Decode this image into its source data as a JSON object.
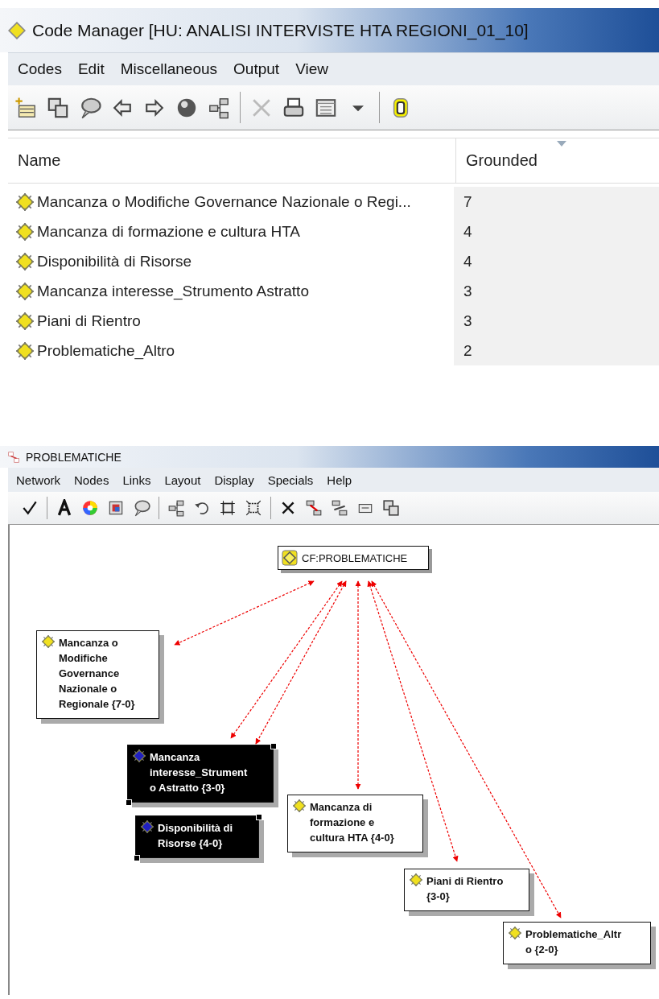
{
  "code_manager": {
    "title": "Code Manager [HU: ANALISI INTERVISTE HTA REGIONI_01_10]",
    "menu": [
      "Codes",
      "Edit",
      "Miscellaneous",
      "Output",
      "View"
    ],
    "columns": [
      "Name",
      "Grounded"
    ],
    "rows": [
      {
        "name": "Mancanza o Modifiche Governance Nazionale o Regi...",
        "grounded": "7"
      },
      {
        "name": "Mancanza di formazione e cultura HTA",
        "grounded": "4"
      },
      {
        "name": "Disponibilità di Risorse",
        "grounded": "4"
      },
      {
        "name": "Mancanza interesse_Strumento Astratto",
        "grounded": "3"
      },
      {
        "name": "Piani di Rientro",
        "grounded": "3"
      },
      {
        "name": "Problematiche_Altro",
        "grounded": "2"
      }
    ]
  },
  "network": {
    "title": "PROBLEMATICHE",
    "menu": [
      "Network",
      "Nodes",
      "Links",
      "Layout",
      "Display",
      "Specials",
      "Help"
    ],
    "nodes": [
      {
        "kind": "family",
        "lines": [
          "CF:PROBLEMATICHE"
        ],
        "selected": false
      },
      {
        "kind": "code",
        "lines": [
          "Mancanza o",
          "Modifiche",
          "Governance",
          "Nazionale o",
          "Regionale {7-0}"
        ],
        "selected": false
      },
      {
        "kind": "code",
        "lines": [
          "Mancanza",
          "interesse_Strument",
          "o Astratto {3-0}"
        ],
        "selected": true
      },
      {
        "kind": "code",
        "lines": [
          "Disponibilità di",
          "Risorse {4-0}"
        ],
        "selected": true
      },
      {
        "kind": "code",
        "lines": [
          "Mancanza di",
          "formazione e",
          "cultura HTA {4-0}"
        ],
        "selected": false
      },
      {
        "kind": "code",
        "lines": [
          "Piani di Rientro",
          "{3-0}"
        ],
        "selected": false
      },
      {
        "kind": "code",
        "lines": [
          "Problematiche_Altr",
          "o {2-0}"
        ],
        "selected": false
      }
    ]
  }
}
